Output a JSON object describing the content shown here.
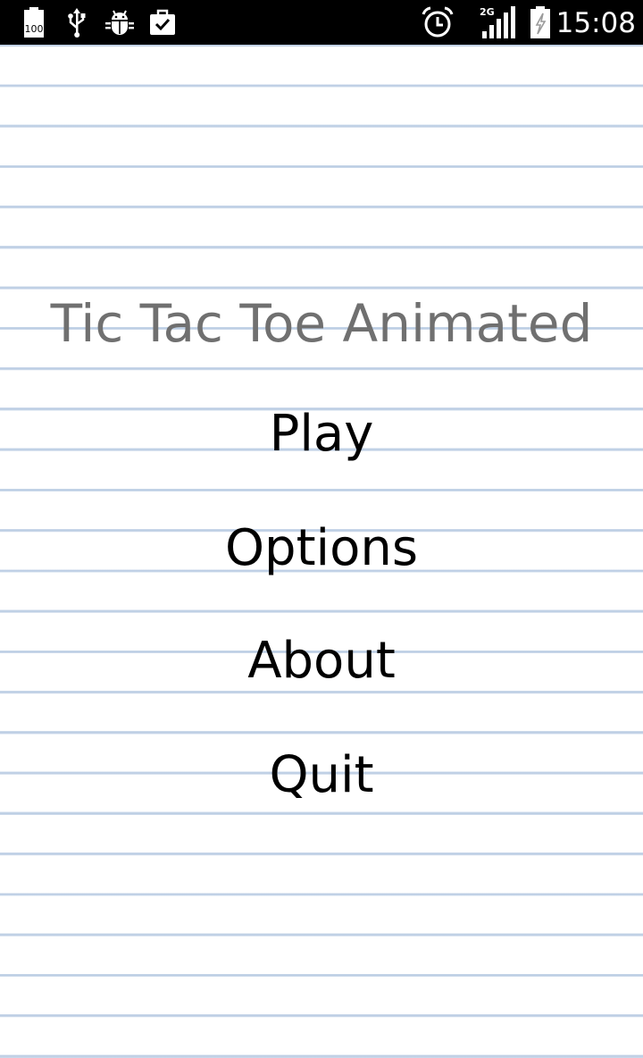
{
  "status_bar": {
    "left_icons": [
      "battery-100-icon",
      "usb-icon",
      "android-debug-icon",
      "task-check-icon"
    ],
    "battery_level_label": "100",
    "right_icons": [
      "alarm-icon",
      "signal-2g-icon",
      "battery-charging-icon"
    ],
    "network_label": "2G",
    "time": "15:08"
  },
  "app": {
    "title": "Tic Tac Toe Animated",
    "menu": [
      {
        "id": "play",
        "label": "Play"
      },
      {
        "id": "options",
        "label": "Options"
      },
      {
        "id": "about",
        "label": "About"
      },
      {
        "id": "quit",
        "label": "Quit"
      }
    ]
  },
  "colors": {
    "title": "#707070",
    "menu_text": "#000000",
    "ruled_line": "#c4d4e8",
    "status_bar": "#000000"
  }
}
